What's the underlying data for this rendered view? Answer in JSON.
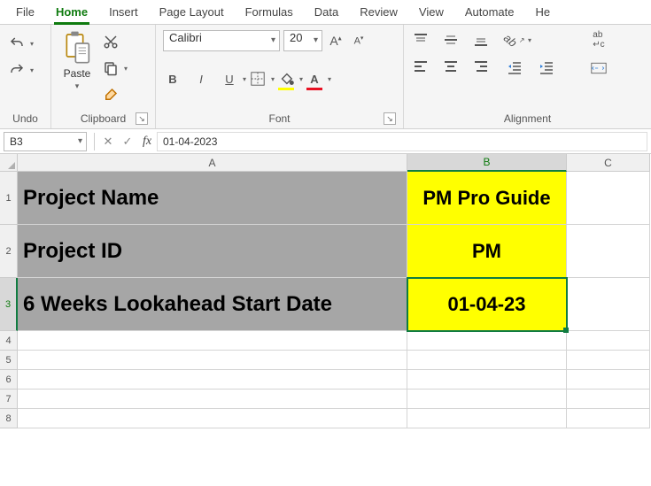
{
  "tabs": {
    "file": "File",
    "home": "Home",
    "insert": "Insert",
    "pagelayout": "Page Layout",
    "formulas": "Formulas",
    "data": "Data",
    "review": "Review",
    "view": "View",
    "automate": "Automate",
    "help": "He"
  },
  "ribbon": {
    "undo_label": "Undo",
    "clipboard_label": "Clipboard",
    "paste_label": "Paste",
    "font_label": "Font",
    "font_name": "Calibri",
    "font_size": "20",
    "bold": "B",
    "italic": "I",
    "underline": "U",
    "alignment_label": "Alignment"
  },
  "formula_bar": {
    "name_box": "B3",
    "fx": "fx",
    "value": "01-04-2023"
  },
  "columns": {
    "A": "A",
    "B": "B",
    "C": "C"
  },
  "rows": {
    "r1": "1",
    "r2": "2",
    "r3": "3",
    "r4": "4",
    "r5": "5",
    "r6": "6",
    "r7": "7",
    "r8": "8"
  },
  "cells": {
    "A1": "Project Name",
    "B1": "PM Pro Guide",
    "A2": "Project ID",
    "B2": "PM",
    "A3": "6 Weeks Lookahead Start Date",
    "B3": "01-04-23"
  }
}
